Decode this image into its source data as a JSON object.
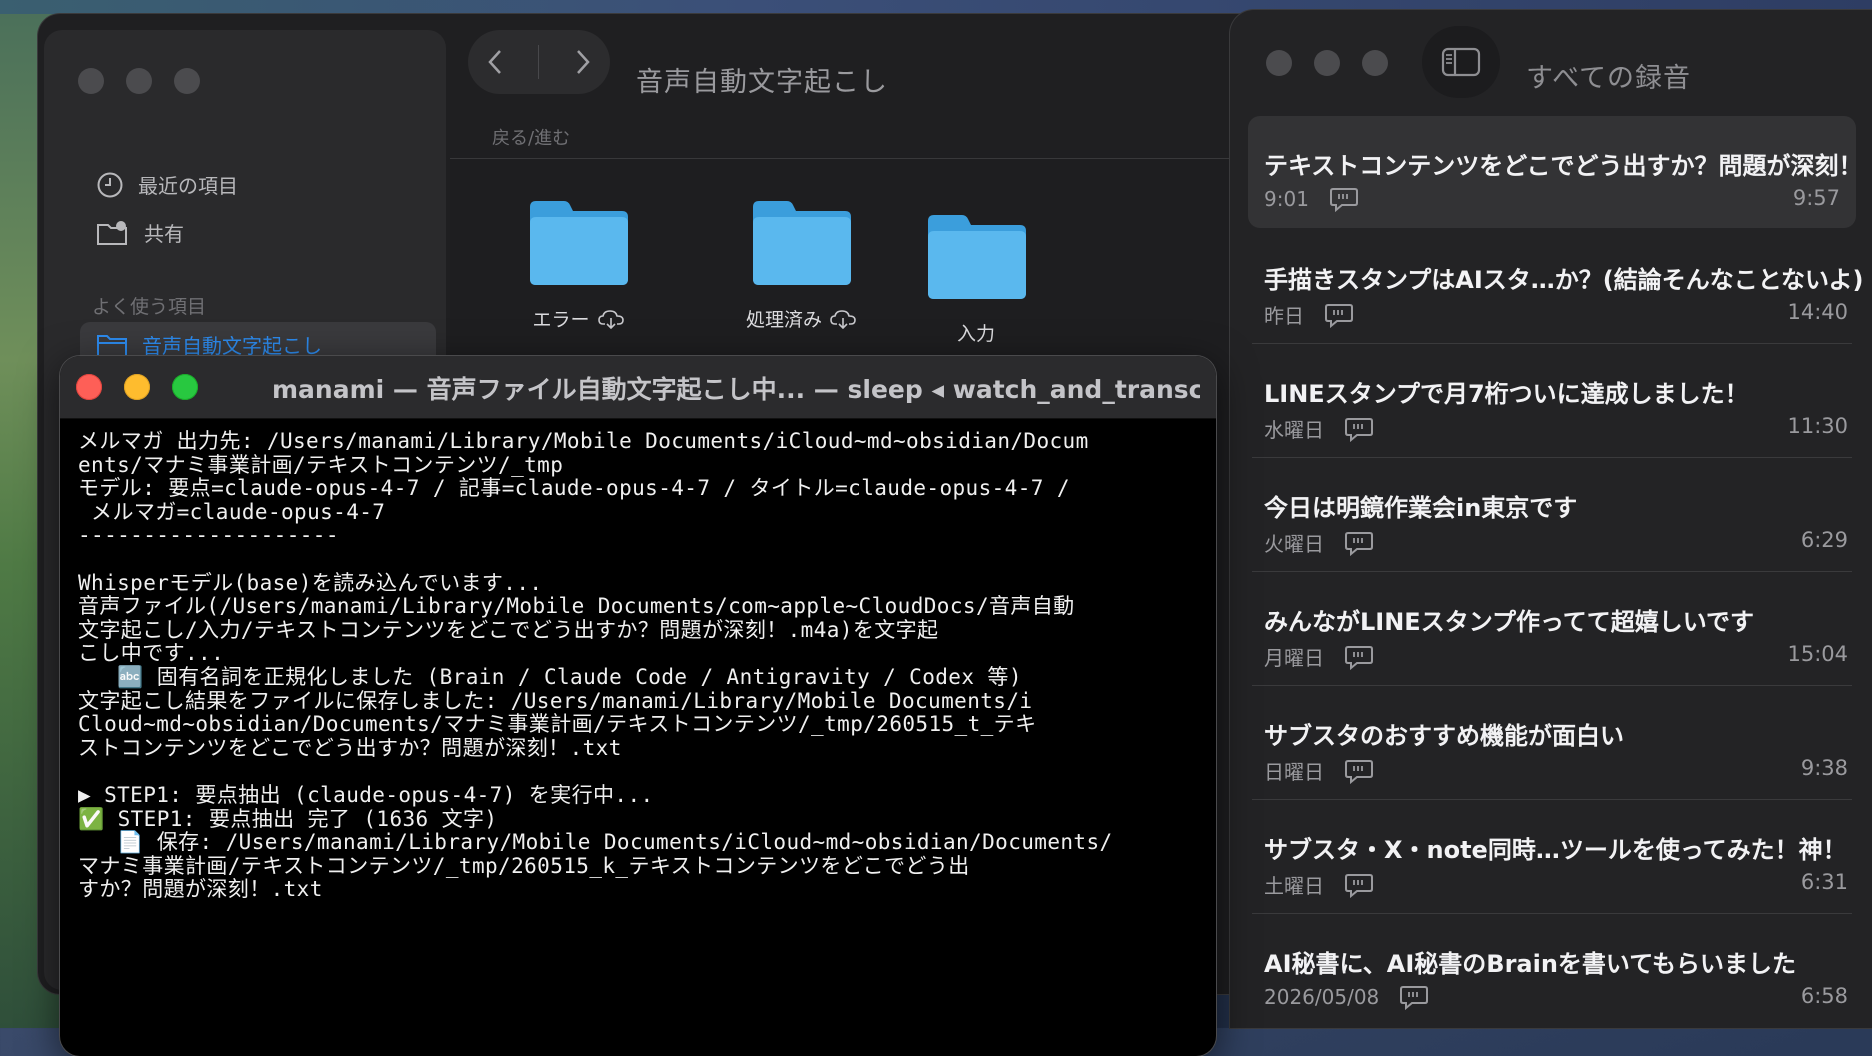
{
  "finder": {
    "title": "音声自動文字起こし",
    "nav_label": "戻る/進む",
    "sidebar": {
      "recent": "最近の項目",
      "shared": "共有",
      "favorites_header": "よく使う項目",
      "selected_folder": "音声自動文字起こし"
    },
    "folders": [
      {
        "label": "エラー"
      },
      {
        "label": "処理済み"
      },
      {
        "label": "入力"
      }
    ]
  },
  "memos": {
    "title": "すべての録音",
    "items": [
      {
        "title": "テキストコンテンツをどこでどう出すか？問題が深刻！",
        "date": "9:01",
        "duration": "9:57"
      },
      {
        "title": "手描きスタンプはAIスタ…か？(結論そんなことないよ)",
        "date": "昨日",
        "duration": "14:40"
      },
      {
        "title": "LINEスタンプで月7桁ついに達成しました！",
        "date": "水曜日",
        "duration": "11:30"
      },
      {
        "title": "今日は明鏡作業会in東京です",
        "date": "火曜日",
        "duration": "6:29"
      },
      {
        "title": "みんながLINEスタンプ作ってて超嬉しいです",
        "date": "月曜日",
        "duration": "15:04"
      },
      {
        "title": "サブスタのおすすめ機能が面白い",
        "date": "日曜日",
        "duration": "9:38"
      },
      {
        "title": "サブスタ・X・note同時…ツールを使ってみた！神！",
        "date": "土曜日",
        "duration": "6:31"
      },
      {
        "title": "AI秘書に、AI秘書のBrainを書いてもらいました",
        "date": "2026/05/08",
        "duration": "6:58"
      }
    ]
  },
  "terminal": {
    "title": "manami — 音声ファイル自動文字起こし中... — sleep ◂ watch_and_transcribe....",
    "lines": [
      "メルマガ 出力先: /Users/manami/Library/Mobile Documents/iCloud~md~obsidian/Docum",
      "ents/マナミ事業計画/テキストコンテンツ/_tmp",
      "モデル: 要点=claude-opus-4-7 / 記事=claude-opus-4-7 / タイトル=claude-opus-4-7 /",
      " メルマガ=claude-opus-4-7",
      "--------------------",
      "",
      "Whisperモデル(base)を読み込んでいます...",
      "音声ファイル(/Users/manami/Library/Mobile Documents/com~apple~CloudDocs/音声自動",
      "文字起こし/入力/テキストコンテンツをどこでどう出すか？問題が深刻！.m4a)を文字起",
      "こし中です...",
      "   🔤 固有名詞を正規化しました (Brain / Claude Code / Antigravity / Codex 等)",
      "文字起こし結果をファイルに保存しました: /Users/manami/Library/Mobile Documents/i",
      "Cloud~md~obsidian/Documents/マナミ事業計画/テキストコンテンツ/_tmp/260515_t_テキ",
      "ストコンテンツをどこでどう出すか？問題が深刻！.txt",
      "",
      "▶ STEP1: 要点抽出 (claude-opus-4-7) を実行中...",
      "✅ STEP1: 要点抽出 完了 (1636 文字)",
      "   📄 保存: /Users/manami/Library/Mobile Documents/iCloud~md~obsidian/Documents/",
      "マナミ事業計画/テキストコンテンツ/_tmp/260515_k_テキストコンテンツをどこでどう出",
      "すか？問題が深刻！.txt"
    ]
  }
}
